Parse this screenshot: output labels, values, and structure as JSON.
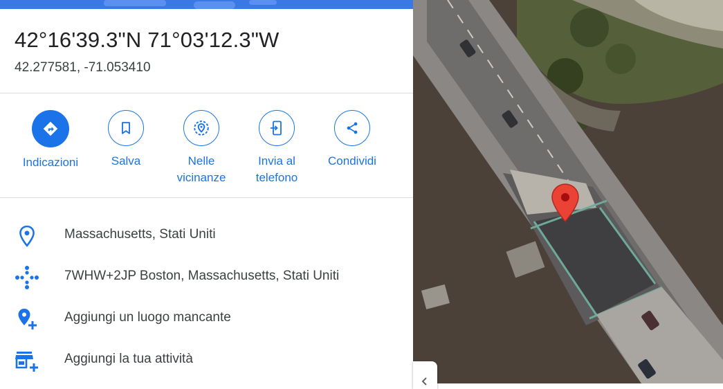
{
  "place": {
    "title": "42°16'39.3\"N 71°03'12.3\"W",
    "decimal": "42.277581, -71.053410"
  },
  "actions": [
    {
      "label": "Indicazioni",
      "icon": "directions-icon"
    },
    {
      "label": "Salva",
      "icon": "bookmark-icon"
    },
    {
      "label": "Nelle vicinanze",
      "icon": "nearby-icon"
    },
    {
      "label": "Invia al telefono",
      "icon": "send-to-phone-icon"
    },
    {
      "label": "Condividi",
      "icon": "share-icon"
    }
  ],
  "details": [
    {
      "text": "Massachusetts, Stati Uniti",
      "icon": "location-pin-icon"
    },
    {
      "text": "7WHW+2JP Boston, Massachusetts, Stati Uniti",
      "icon": "plus-code-icon"
    },
    {
      "text": "Aggiungi un luogo mancante",
      "icon": "add-place-icon"
    },
    {
      "text": "Aggiungi la tua attività",
      "icon": "add-business-icon"
    }
  ],
  "colors": {
    "accent": "#1a73e8",
    "marker": "#ea4335",
    "water": "#4a4038"
  }
}
